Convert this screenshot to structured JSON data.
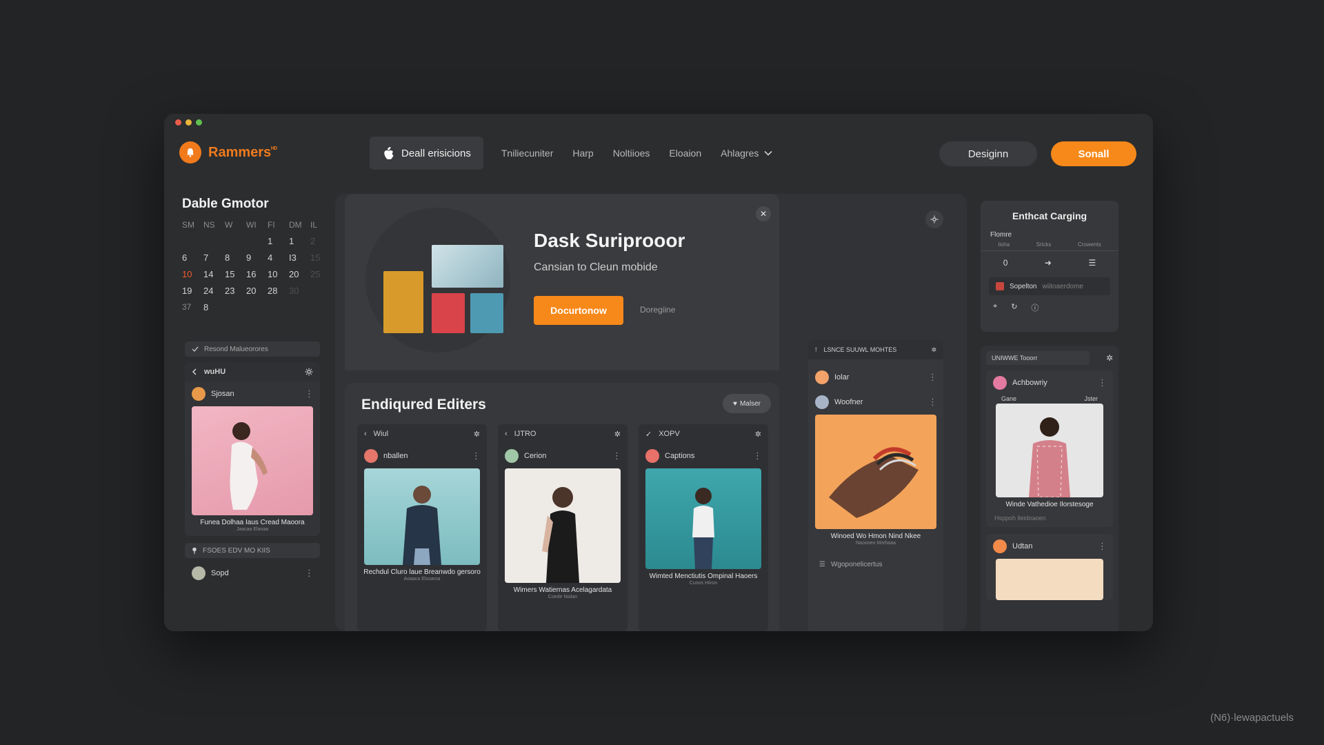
{
  "app": {
    "logo_text": "Rammers",
    "logo_sup": "ᴴᴰ"
  },
  "nav": {
    "primary": "Deall erisicions",
    "items": [
      "Tniliecuniter",
      "Harp",
      "Noltiioes",
      "Eloaion",
      "Ahlagres"
    ],
    "btn_secondary": "Desiginn",
    "btn_primary": "Sonall"
  },
  "calendar": {
    "title": "Dable Gmotor",
    "weekdays": [
      "SM",
      "NS",
      "W",
      "WI",
      "FI",
      "DM",
      "IL"
    ],
    "rows": [
      [
        "",
        "",
        "",
        "",
        "1",
        "1",
        "2"
      ],
      [
        "6",
        "7",
        "8",
        "9",
        "4",
        "I3",
        "15"
      ],
      [
        "10",
        "14",
        "15",
        "16",
        "10",
        "20",
        "25"
      ],
      [
        "19",
        "24",
        "23",
        "20",
        "28",
        "30",
        ""
      ],
      [
        "37",
        "8",
        "",
        "",
        "",
        "",
        ""
      ]
    ]
  },
  "left": {
    "strip": "Resond Malueorores",
    "card_title": "wuHU",
    "person1": "Sjosan",
    "caption1": "Funea Dolhaa Iaus Cread Maoora",
    "caption1_sub": "Jaacaa Elanaa",
    "strip2": "FSOES EDV MO KIIS",
    "person2": "Sopd"
  },
  "hero": {
    "title": "Dask Suriprooor",
    "subtitle": "Cansian to Cleun mobide",
    "button": "Docurtonow",
    "link": "Doregiine"
  },
  "featured": {
    "title": "Endiqured Editers",
    "pill": "Malser",
    "cards": [
      {
        "head": "Wiul",
        "person": "nballen",
        "caption": "Rechdul Cluro laue Breanwdo gersoro",
        "sub": "Aoaaca Elsoarsa"
      },
      {
        "head": "IJTRO",
        "person": "Cerion",
        "caption": "Wimers Watiernas Acelagardata",
        "sub": "Coede Noilan"
      },
      {
        "head": "XOPV",
        "person": "Captions",
        "caption": "Wimted Menctiutis Ompinal Haoers",
        "sub": "Cuoos Hiiron"
      }
    ]
  },
  "middle": {
    "header": "LSNCE SUUWL MOHTES",
    "person1": "Iolar",
    "person2": "Woofner",
    "caption": "Winoed Wo Hmon Nind Nkee",
    "caption_sub": "Naoooeo Morhaaa",
    "footer": "Wgoponelicertus"
  },
  "rpanel": {
    "title": "Enthcat Carging",
    "subtitle": "Flomre",
    "cols": [
      "Iisha",
      "Sricks",
      "Crowents"
    ],
    "value": "0",
    "row_text": "Sopelton",
    "row_sub": "wiitoaerdome"
  },
  "rcol": {
    "header": "UNIWWE Tooorr",
    "person1": "Achbowriy",
    "tag_left": "Gane",
    "tag_right": "Jster",
    "caption": "Winde Vathedioe Ilorstesoge",
    "sub": "Hsppoh lleidoaoen",
    "person2": "Udtan"
  },
  "watermark": "(N6)·lewapactuels",
  "colors": {
    "accent": "#f7891a",
    "bg": "#232426",
    "window": "#2c2d2f"
  }
}
